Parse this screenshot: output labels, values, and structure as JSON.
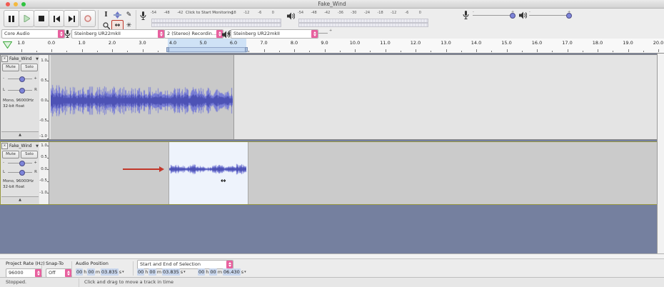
{
  "window": {
    "title": "Fake_Wind"
  },
  "icons": {
    "selection_tool": "I",
    "draw_tool": "✎",
    "timeshift_tool": "↔",
    "multi_tool": "✳",
    "cut": "✂",
    "undo": "↶",
    "redo": "↷",
    "track_menu_caret": "▼",
    "track_collapse": "▲",
    "field_caret": "▾",
    "close": "x",
    "drag_cursor": "↔",
    "minus": "-",
    "plus": "+",
    "pan_left": "L",
    "pan_right": "R"
  },
  "meters": {
    "recording": {
      "scale_left": [
        "-54",
        "-48",
        "-42"
      ],
      "monitor_label": "Click to Start Monitoring",
      "scale_right": [
        "-18",
        "-12",
        "-6",
        "0"
      ]
    },
    "playback": {
      "scale": [
        "-54",
        "-48",
        "-42",
        "-36",
        "-30",
        "-24",
        "-18",
        "-12",
        "-6",
        "0"
      ]
    }
  },
  "device": {
    "host": "Core Audio",
    "recording_device": "Steinberg UR22mkII",
    "recording_channels": "2 (Stereo) Recordin...",
    "playback_device": "Steinberg UR22mkII"
  },
  "timeline": {
    "labels": [
      "1.0",
      "0.0",
      "1.0",
      "2.0",
      "3.0",
      "4.0",
      "5.0",
      "6.0",
      "7.0",
      "8.0",
      "9.0",
      "10.0",
      "11.0",
      "12.0",
      "13.0",
      "14.0",
      "15.0",
      "16.0",
      "17.0",
      "18.0",
      "19.0",
      "20.0"
    ],
    "selection_start_s": 3.835,
    "selection_end_s": 6.43
  },
  "tracks": [
    {
      "name": "Fake_Wind",
      "mute_label": "Mute",
      "solo_label": "Solo",
      "format_line1": "Mono, 96000Hz",
      "format_line2": "32-bit float",
      "scale_labels": [
        "1.0",
        "0.5",
        "0.0",
        "-0.5",
        "-1.0"
      ],
      "clip": {
        "start_s": 0.0,
        "end_s": 5.95,
        "amplitude": 0.24
      }
    },
    {
      "name": "Fake_Wind",
      "mute_label": "Mute",
      "solo_label": "Solo",
      "format_line1": "Mono, 96000Hz",
      "format_line2": "32-bit float",
      "scale_labels": [
        "1.0",
        "0.5",
        "0.0",
        "-0.5",
        "-1.0"
      ],
      "clip": {
        "start_s": 3.835,
        "end_s": 6.43,
        "amplitude": 0.115
      }
    }
  ],
  "selection_toolbar": {
    "project_rate_label": "Project Rate (Hz)",
    "project_rate_value": "96000",
    "snap_label": "Snap-To",
    "snap_value": "Off",
    "audio_position_label": "Audio Position",
    "selection_mode": "Start and End of Selection",
    "unit_h": "h",
    "unit_m": "m",
    "unit_s": "s",
    "audio_position": {
      "h": "00",
      "m": "00",
      "s": "03.835"
    },
    "selection_start": {
      "h": "00",
      "m": "00",
      "s": "03.835"
    },
    "selection_end": {
      "h": "00",
      "m": "00",
      "s": "06.430"
    }
  },
  "status": {
    "state": "Stopped.",
    "hint": "Click and drag to move a track in time"
  },
  "colors": {
    "accent_pink": "#e8619f",
    "waveform": "#7a7fd6",
    "waveform_dark": "#4d52b5",
    "selection_blue": "#cfe2f6",
    "workspace_slate": "#75809f",
    "focus_border": "#97973f",
    "annotation_arrow": "#c2372a"
  }
}
